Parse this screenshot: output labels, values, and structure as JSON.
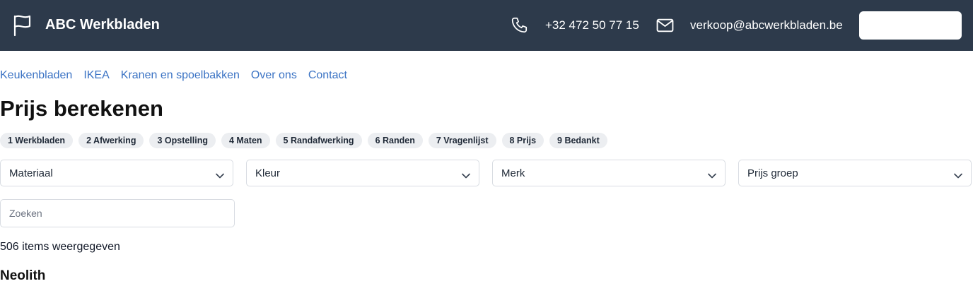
{
  "header": {
    "brand_icon": "flag-icon",
    "brand_name": "ABC Werkbladen",
    "phone_icon": "phone-icon",
    "phone": "+32 472 50 77 15",
    "mail_icon": "mail-icon",
    "email": "verkoop@abcwerkbladen.be",
    "button_label": "",
    "background_color": "#2d3a4b"
  },
  "nav": {
    "items": [
      {
        "label": "Keukenbladen"
      },
      {
        "label": "IKEA"
      },
      {
        "label": "Kranen en spoelbakken"
      },
      {
        "label": "Over ons"
      },
      {
        "label": "Contact"
      }
    ],
    "link_color": "#3b73c4"
  },
  "page": {
    "title": "Prijs berekenen"
  },
  "steps": [
    {
      "label": "1 Werkbladen"
    },
    {
      "label": "2 Afwerking"
    },
    {
      "label": "3 Opstelling"
    },
    {
      "label": "4 Maten"
    },
    {
      "label": "5 Randafwerking"
    },
    {
      "label": "6 Randen"
    },
    {
      "label": "7 Vragenlijst"
    },
    {
      "label": "8 Prijs"
    },
    {
      "label": "9 Bedankt"
    }
  ],
  "filters": [
    {
      "label": "Materiaal"
    },
    {
      "label": "Kleur"
    },
    {
      "label": "Merk"
    },
    {
      "label": "Prijs groep"
    }
  ],
  "search": {
    "placeholder": "Zoeken",
    "value": ""
  },
  "results": {
    "count_text": "506 items weergegeven",
    "first_group": "Neolith"
  }
}
